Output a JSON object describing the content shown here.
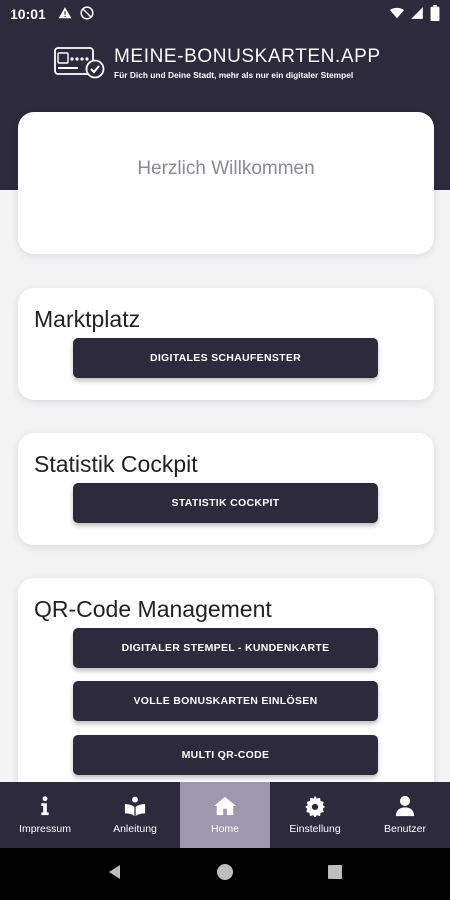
{
  "status_bar": {
    "time": "10:01",
    "left_icons": [
      "alert-icon",
      "do-not-disturb-icon"
    ],
    "right_icons": [
      "wifi-icon",
      "signal-icon",
      "battery-icon"
    ]
  },
  "header": {
    "brand": "MEINE-BONUSKARTEN.APP",
    "tagline": "Für Dich und Deine Stadt, mehr als nur ein digitaler Stempel"
  },
  "welcome": {
    "text": "Herzlich Willkommen"
  },
  "sections": {
    "marktplatz": {
      "title": "Marktplatz",
      "buttons": [
        "DIGITALES SCHAUFENSTER"
      ]
    },
    "statistik": {
      "title": "Statistik Cockpit",
      "buttons": [
        "STATISTIK COCKPIT"
      ]
    },
    "qr": {
      "title": "QR-Code Management",
      "buttons": [
        "DIGITALER STEMPEL - KUNDENKARTE",
        "VOLLE BONUSKARTEN EINLÖSEN",
        "MULTI QR-CODE"
      ]
    }
  },
  "bottom_nav": {
    "items": [
      {
        "label": "Impressum",
        "icon": "info-icon"
      },
      {
        "label": "Anleitung",
        "icon": "book-reader-icon"
      },
      {
        "label": "Home",
        "icon": "home-icon",
        "active": true
      },
      {
        "label": "Einstellung",
        "icon": "gear-icon"
      },
      {
        "label": "Benutzer",
        "icon": "user-icon"
      }
    ]
  },
  "colors": {
    "primary": "#2d2a3e",
    "active_tab": "#9d98ad",
    "background": "#f3f3f4"
  }
}
